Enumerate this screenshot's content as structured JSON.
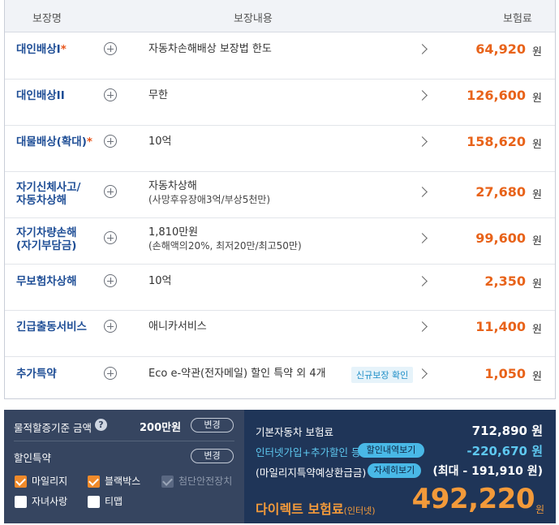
{
  "table": {
    "headers": {
      "name": "보장명",
      "content": "보장내용",
      "premium": "보험료"
    },
    "won": "원",
    "rows": [
      {
        "name": "대인배상I",
        "star": "*",
        "content": "자동차손해배상 보장법 한도",
        "sub": "",
        "price": "64,920",
        "badge": ""
      },
      {
        "name": "대인배상II",
        "star": "",
        "content": "무한",
        "sub": "",
        "price": "126,600",
        "badge": ""
      },
      {
        "name": "대물배상(확대)",
        "star": "*",
        "content": "10억",
        "sub": "",
        "price": "158,620",
        "badge": ""
      },
      {
        "name": "자기신체사고/",
        "name2": "자동차상해",
        "star": "",
        "content": "자동차상해",
        "sub": "(사망후유장애3억/부상5천만)",
        "price": "27,680",
        "badge": ""
      },
      {
        "name": "자기차량손해",
        "name2": "(자기부담금)",
        "star": "",
        "content": "1,810만원",
        "sub": "(손해액의20%, 최저20만/최고50만)",
        "price": "99,600",
        "badge": ""
      },
      {
        "name": "무보험차상해",
        "star": "",
        "content": "10억",
        "sub": "",
        "price": "2,350",
        "badge": ""
      },
      {
        "name": "긴급출동서비스",
        "star": "",
        "content": "애니카서비스",
        "sub": "",
        "price": "11,400",
        "badge": ""
      },
      {
        "name": "추가특약",
        "star": "",
        "content": "Eco e-약관(전자메일) 할인 특약 외 4개",
        "sub": "",
        "price": "1,050",
        "badge": "신규보장 확인"
      }
    ]
  },
  "left_panel": {
    "property_label": "물적할증기준 금액",
    "help": "?",
    "property_amount": "200만원",
    "change_label": "변경",
    "discount_label": "할인특약",
    "discount_change_label": "변경",
    "options": [
      {
        "label": "마일리지",
        "state": "checked"
      },
      {
        "label": "블랙박스",
        "state": "checked"
      },
      {
        "label": "첨단안전장치",
        "state": "disabled"
      },
      {
        "label": "자녀사랑",
        "state": "unchecked"
      },
      {
        "label": "티맵",
        "state": "unchecked"
      }
    ]
  },
  "right_panel": {
    "base_label": "기본자동차 보험료",
    "base_value": "712,890 원",
    "net_label": "인터넷가입+추가할인 등",
    "net_button": "할인내역보기",
    "net_value": "-220,670 원",
    "mileage_label": "(마일리지특약예상환급금)",
    "mileage_button": "자세히보기",
    "mileage_value": "(최대 - 191,910 원)",
    "direct_label": "다이렉트 보험료",
    "direct_suffix": "(인터넷)",
    "total": "492,220",
    "total_won": "원"
  },
  "colors": {
    "accent_orange": "#e8631a",
    "name_blue": "#1f4e96",
    "panel_dark": "#1f3558",
    "panel_left": "#364560",
    "cyan": "#5ec8f0"
  }
}
